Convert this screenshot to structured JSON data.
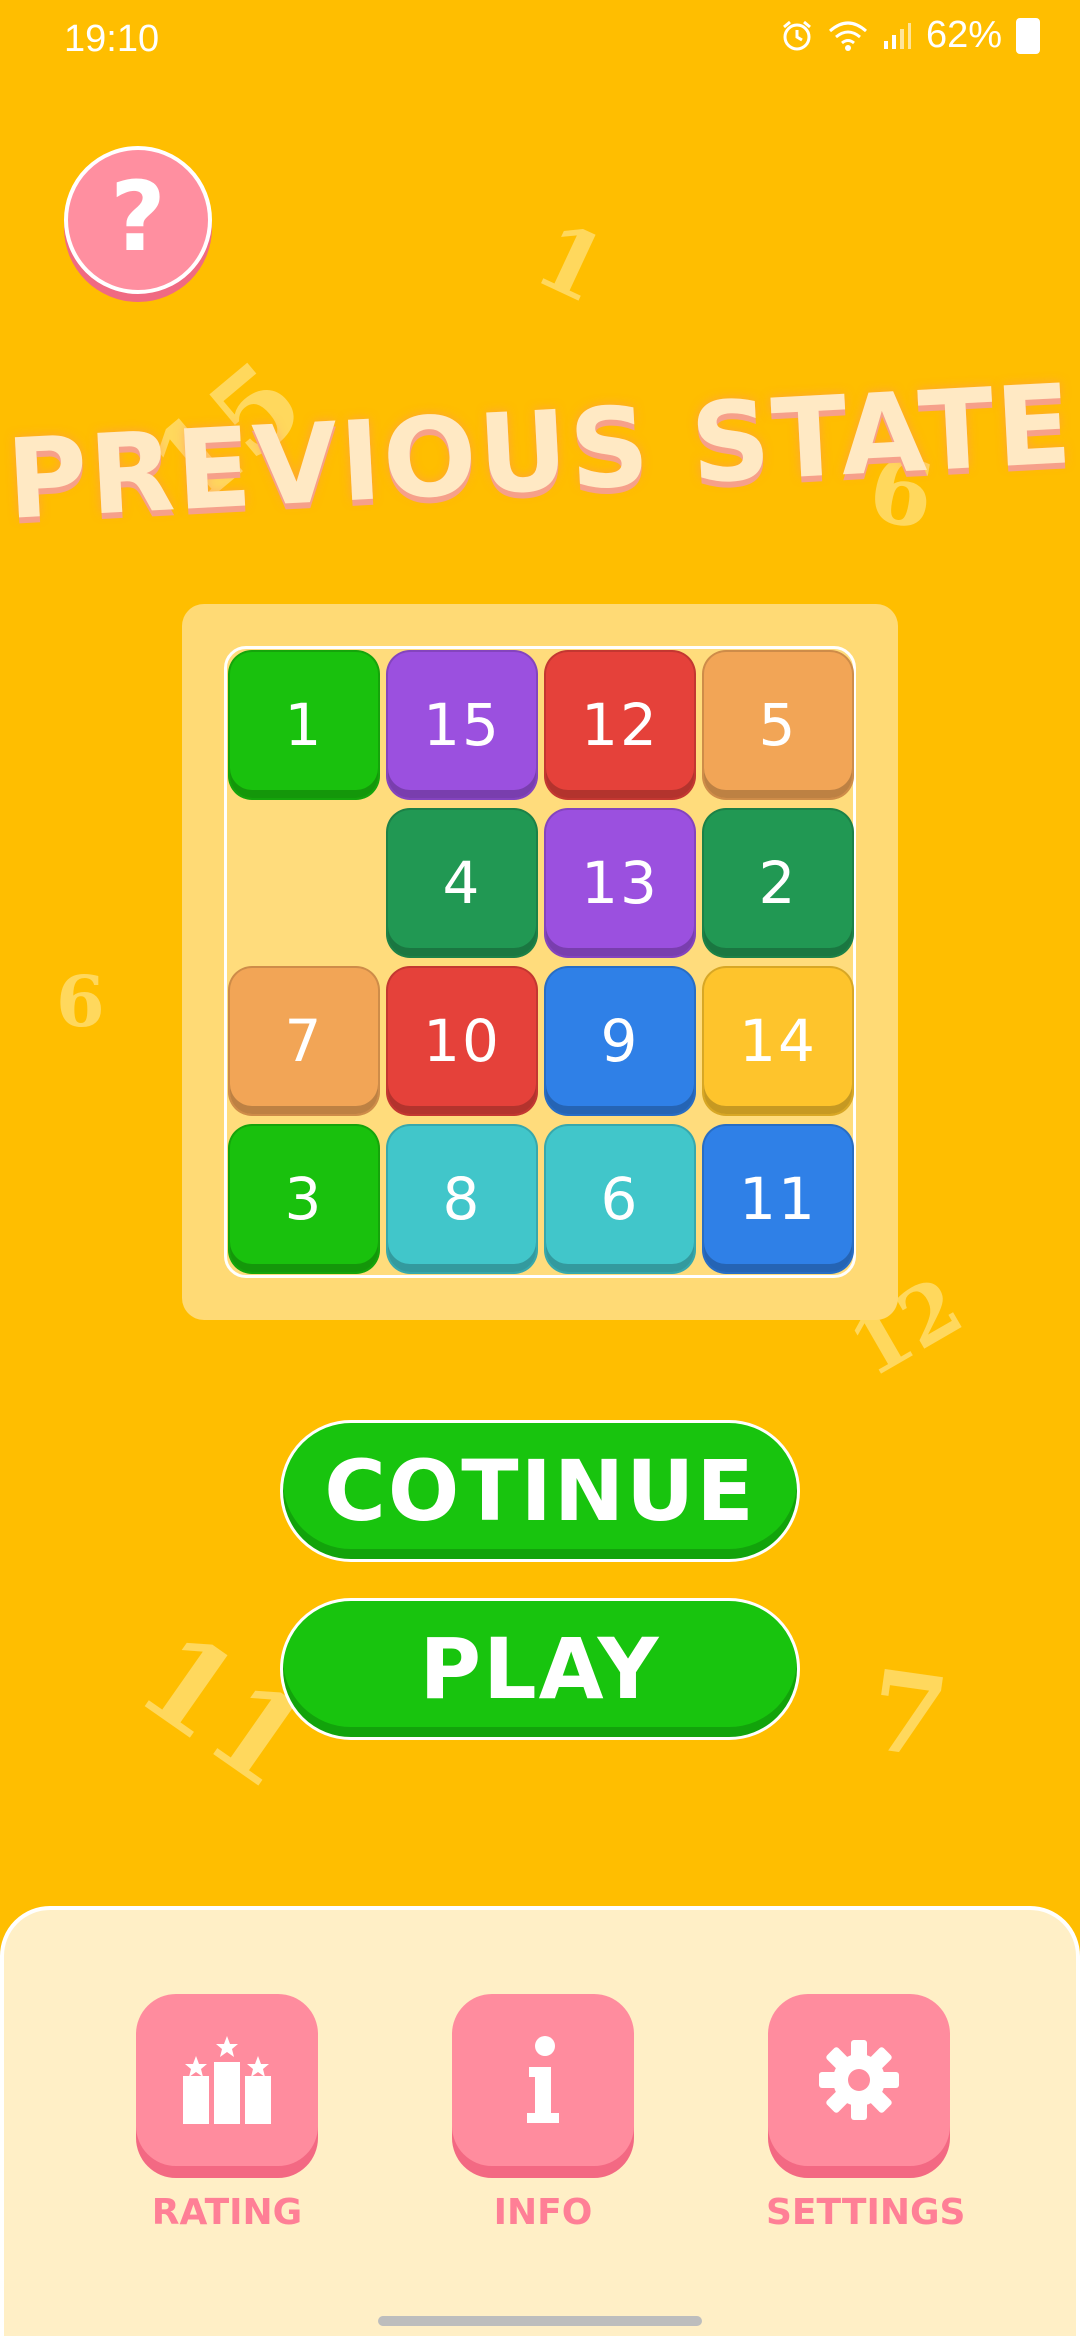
{
  "status_bar": {
    "time": "19:10",
    "battery": "62%"
  },
  "background_numbers": [
    "1",
    "15",
    "6",
    "6",
    "12",
    "11",
    "7"
  ],
  "help_button": {
    "label": "?",
    "color": "#FF8FA0"
  },
  "title": "PREVIOUS STATE",
  "board": {
    "rows": [
      [
        {
          "n": "1",
          "color": "#19C10D"
        },
        {
          "n": "15",
          "color": "#9B50DF"
        },
        {
          "n": "12",
          "color": "#E5413A"
        },
        {
          "n": "5",
          "color": "#F2A556"
        }
      ],
      [
        null,
        {
          "n": "4",
          "color": "#219853"
        },
        {
          "n": "13",
          "color": "#9B50DF"
        },
        {
          "n": "2",
          "color": "#219853"
        }
      ],
      [
        {
          "n": "7",
          "color": "#F2A556"
        },
        {
          "n": "10",
          "color": "#E5413A"
        },
        {
          "n": "9",
          "color": "#2F80E7"
        },
        {
          "n": "14",
          "color": "#FEC42C"
        }
      ],
      [
        {
          "n": "3",
          "color": "#19C10D"
        },
        {
          "n": "8",
          "color": "#41C6CA"
        },
        {
          "n": "6",
          "color": "#41C6CA"
        },
        {
          "n": "11",
          "color": "#2F80E7"
        }
      ]
    ]
  },
  "buttons": {
    "continue": "COTINUE",
    "play": "PLAY"
  },
  "bottom_nav": {
    "rating": {
      "label": "RATING",
      "icon": "podium-stars-icon"
    },
    "info": {
      "label": "INFO",
      "icon": "info-icon"
    },
    "settings": {
      "label": "SETTINGS",
      "icon": "gear-icon"
    }
  },
  "colors": {
    "background": "#FFBE00",
    "panel": "#FFEFC6",
    "accent_pink": "#FF8C9E",
    "button_green": "#18C40E"
  }
}
